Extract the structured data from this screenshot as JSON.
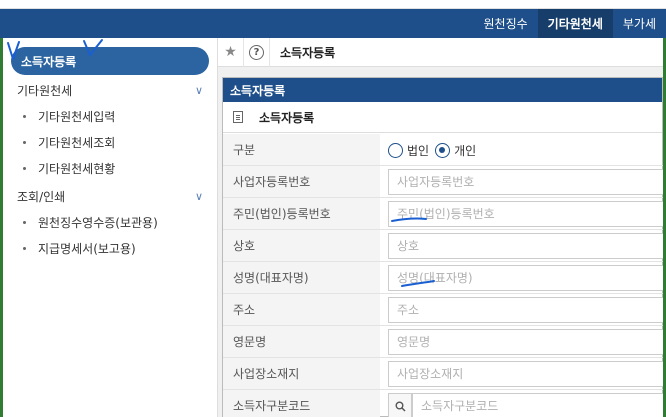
{
  "top_nav": {
    "items": [
      {
        "label": "원천징수",
        "active": false
      },
      {
        "label": "기타원천세",
        "active": true
      },
      {
        "label": "부가세",
        "active": false
      }
    ]
  },
  "sidebar": {
    "header": "소득자등록",
    "groups": [
      {
        "label": "기타원천세",
        "items": [
          "기타원천세입력",
          "기타원천세조회",
          "기타원천세현황"
        ]
      },
      {
        "label": "조회/인쇄",
        "items": [
          "원천징수영수증(보관용)",
          "지급명세서(보고용)"
        ]
      }
    ]
  },
  "tabbar": {
    "title": "소득자등록",
    "star_icon": "star-icon",
    "help_icon": "help-icon"
  },
  "dialog": {
    "title": "소득자등록",
    "subtitle": "소득자등록",
    "fields": {
      "type": {
        "label": "구분",
        "options": [
          "법인",
          "개인"
        ],
        "selected": "개인"
      },
      "biz_no": {
        "label": "사업자등록번호",
        "placeholder": "사업자등록번호"
      },
      "resident_no": {
        "label": "주민(법인)등록번호",
        "placeholder": "주민(법인)등록번호"
      },
      "company": {
        "label": "상호",
        "placeholder": "상호"
      },
      "name": {
        "label": "성명(대표자명)",
        "placeholder": "성명(대표자명)"
      },
      "address": {
        "label": "주소",
        "placeholder": "주소"
      },
      "eng_name": {
        "label": "영문명",
        "placeholder": "영문명"
      },
      "biz_location": {
        "label": "사업장소재지",
        "placeholder": "사업장소재지"
      },
      "income_code": {
        "label": "소득자구분코드",
        "placeholder": "소득자구분코드"
      }
    }
  },
  "colors": {
    "primary": "#1e4f8a",
    "sidebar_header": "#2b64a0",
    "frame_border": "#2e7d32",
    "annotation": "#1a5fd1"
  }
}
